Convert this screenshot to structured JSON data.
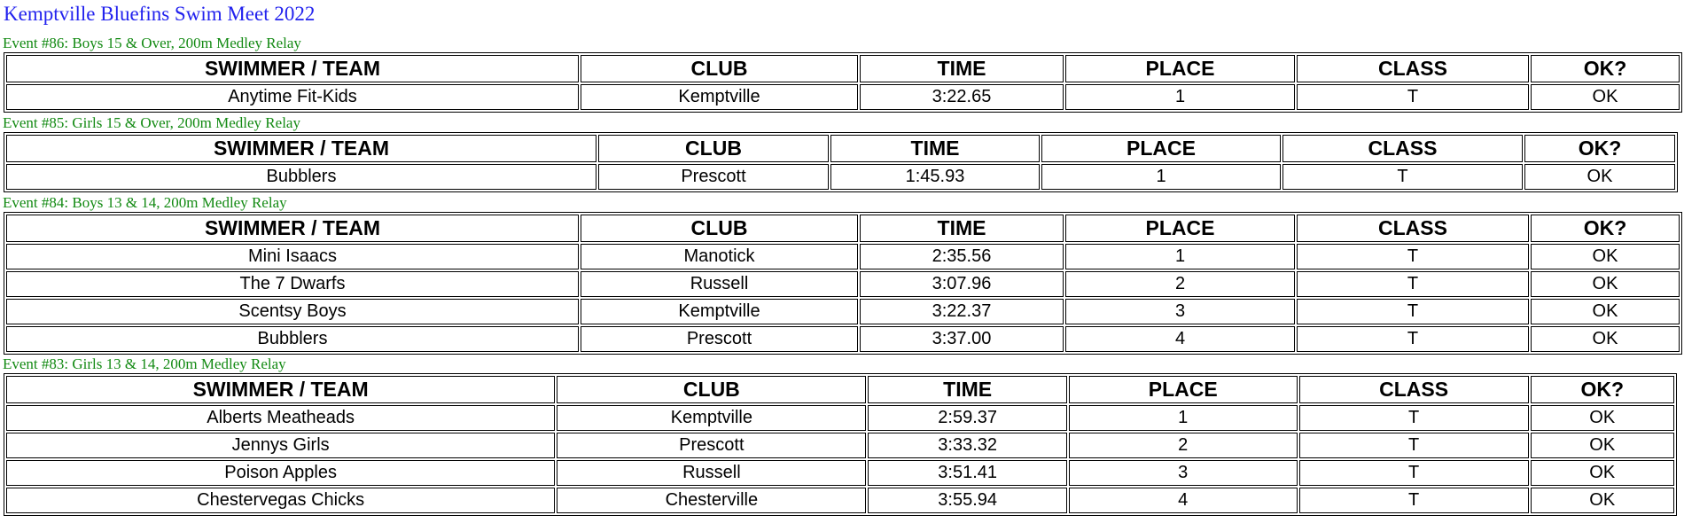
{
  "page": {
    "title": "Kemptville Bluefins Swim Meet 2022"
  },
  "columns": [
    "SWIMMER / TEAM",
    "CLUB",
    "TIME",
    "PLACE",
    "CLASS",
    "OK?"
  ],
  "events": [
    {
      "title": "Event #86: Boys 15 & Over, 200m Medley Relay",
      "rows": [
        [
          "Anytime Fit-Kids",
          "Kemptville",
          "3:22.65",
          "1",
          "T",
          "OK"
        ]
      ]
    },
    {
      "title": "Event #85: Girls 15 & Over, 200m Medley Relay",
      "rows": [
        [
          "Bubblers",
          "Prescott",
          "1:45.93",
          "1",
          "T",
          "OK"
        ]
      ]
    },
    {
      "title": "Event #84: Boys 13 & 14, 200m Medley Relay",
      "rows": [
        [
          "Mini Isaacs",
          "Manotick",
          "2:35.56",
          "1",
          "T",
          "OK"
        ],
        [
          "The 7 Dwarfs",
          "Russell",
          "3:07.96",
          "2",
          "T",
          "OK"
        ],
        [
          "Scentsy Boys",
          "Kemptville",
          "3:22.37",
          "3",
          "T",
          "OK"
        ],
        [
          "Bubblers",
          "Prescott",
          "3:37.00",
          "4",
          "T",
          "OK"
        ]
      ]
    },
    {
      "title": "Event #83: Girls 13 & 14, 200m Medley Relay",
      "rows": [
        [
          "Alberts Meatheads",
          "Kemptville",
          "2:59.37",
          "1",
          "T",
          "OK"
        ],
        [
          "Jennys Girls",
          "Prescott",
          "3:33.32",
          "2",
          "T",
          "OK"
        ],
        [
          "Poison Apples",
          "Russell",
          "3:51.41",
          "3",
          "T",
          "OK"
        ],
        [
          "Chestervegas Chicks",
          "Chesterville",
          "3:55.94",
          "4",
          "T",
          "OK"
        ]
      ]
    }
  ]
}
